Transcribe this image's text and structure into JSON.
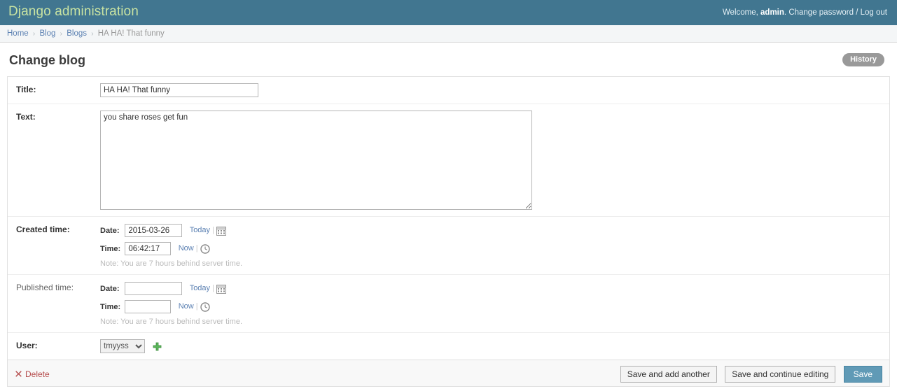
{
  "header": {
    "site_name": "Django administration",
    "welcome_prefix": "Welcome,",
    "username": "admin",
    "separator_dot": ".",
    "change_password": "Change password",
    "slash": "/",
    "logout": "Log out"
  },
  "breadcrumbs": {
    "items": [
      {
        "label": "Home",
        "link": true
      },
      {
        "label": "Blog",
        "link": true
      },
      {
        "label": "Blogs",
        "link": true
      },
      {
        "label": "HA HA! That funny",
        "link": false
      }
    ],
    "separator": "›"
  },
  "page": {
    "title": "Change blog",
    "history_label": "History"
  },
  "form": {
    "title_row": {
      "label": "Title:",
      "value": "HA HA! That funny"
    },
    "text_row": {
      "label": "Text:",
      "value": "you share roses get fun"
    },
    "created_time": {
      "label": "Created time:",
      "date_label": "Date:",
      "date_value": "2015-03-26",
      "today_link": "Today",
      "time_label": "Time:",
      "time_value": "06:42:17",
      "now_link": "Now",
      "note": "Note: You are 7 hours behind server time."
    },
    "published_time": {
      "label": "Published time:",
      "date_label": "Date:",
      "date_value": "",
      "today_link": "Today",
      "time_label": "Time:",
      "time_value": "",
      "now_link": "Now",
      "note": "Note: You are 7 hours behind server time."
    },
    "user_row": {
      "label": "User:",
      "selected": "tmyyss",
      "options": [
        "tmyyss"
      ]
    }
  },
  "submit_row": {
    "delete_label": "Delete",
    "save_add_another": "Save and add another",
    "save_continue": "Save and continue editing",
    "save": "Save"
  },
  "icons": {
    "calendar": "calendar-icon",
    "clock": "clock-icon",
    "add": "add-icon",
    "delete": "delete-icon"
  },
  "colors": {
    "header_bg": "#417690",
    "brand_text": "#c8e3a2",
    "link": "#5b80b2",
    "primary_button": "#609ab6",
    "delete_text": "#b54c4c",
    "add_icon_green": "#4caf50"
  }
}
